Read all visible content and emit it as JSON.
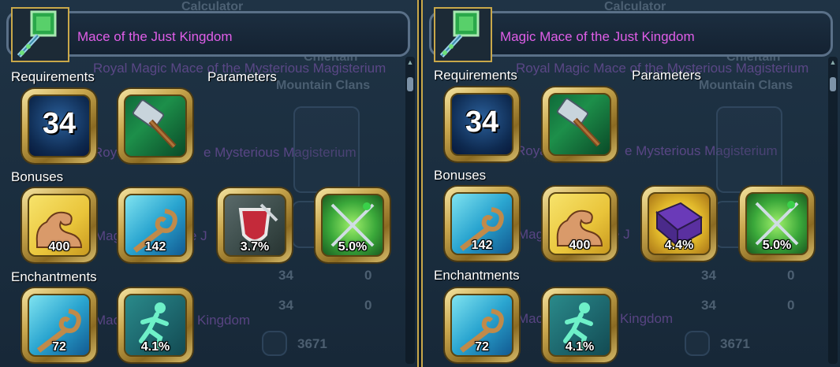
{
  "colors": {
    "gold": "#c9a84a",
    "title_magenta": "#e05ee8",
    "panel_bg": "#1f3345"
  },
  "panels": [
    {
      "title": "Mace of the Just Kingdom",
      "icon": "mace-icon",
      "labels": {
        "requirements": "Requirements",
        "parameters": "Parameters",
        "bonuses": "Bonuses",
        "enchantments": "Enchantments"
      },
      "requirements": {
        "level": "34"
      },
      "parameters": [
        {
          "icon": "hammer-icon"
        }
      ],
      "bonuses": [
        {
          "icon": "strength-icon",
          "value": "400"
        },
        {
          "icon": "wisdom-icon",
          "value": "142"
        },
        {
          "icon": "critical-hit-icon",
          "value": "3.7%"
        },
        {
          "icon": "crossed-weapons-icon",
          "value": "5.0%"
        }
      ],
      "enchantments": [
        {
          "icon": "wisdom-icon",
          "value": "72"
        },
        {
          "icon": "running-man-icon",
          "value": "4.1%"
        }
      ],
      "background": {
        "calculator": "Calculator",
        "chieftain": "Chieftain",
        "mountain_clans": "Mountain Clans",
        "royal_mace": "Royal Magic Mace of the Mysterious Magisterium",
        "royal_mace_2": "Royal",
        "royal_mace_3": "e Mysterious Magisterium",
        "mag": "Mag",
        "mag_j": "e J",
        "le": "Le",
        "mac": "Mac",
        "kingdom": "Kingdom",
        "num_34a": "34",
        "num_0a": "0",
        "num_34b": "34",
        "num_0b": "0",
        "num_3671": "3671"
      }
    },
    {
      "title": "Magic Mace of the Just Kingdom",
      "icon": "mace-icon",
      "labels": {
        "requirements": "Requirements",
        "parameters": "Parameters",
        "bonuses": "Bonuses",
        "enchantments": "Enchantments"
      },
      "requirements": {
        "level": "34"
      },
      "parameters": [
        {
          "icon": "hammer-icon"
        }
      ],
      "bonuses": [
        {
          "icon": "wisdom-icon",
          "value": "142"
        },
        {
          "icon": "strength-icon",
          "value": "400"
        },
        {
          "icon": "magic-book-icon",
          "value": "4.4%"
        },
        {
          "icon": "crossed-weapons-icon",
          "value": "5.0%"
        }
      ],
      "enchantments": [
        {
          "icon": "wisdom-icon",
          "value": "72"
        },
        {
          "icon": "running-man-icon",
          "value": "4.1%"
        }
      ],
      "background": {
        "calculator": "Calculator",
        "chieftain": "Chieftain",
        "mountain_clans": "Mountain Clans",
        "royal_mace": "Royal Magic Mace of the Mysterious Magisterium",
        "royal_mace_2": "Roya",
        "royal_mace_3": "e Mysterious Magisterium",
        "mag": "Mag",
        "mag_j": "e J",
        "le": "Le",
        "mac": "Mac",
        "kingdom": "Kingdom",
        "num_34a": "34",
        "num_0a": "0",
        "num_34b": "34",
        "num_0b": "0",
        "num_3671": "3671"
      }
    }
  ]
}
